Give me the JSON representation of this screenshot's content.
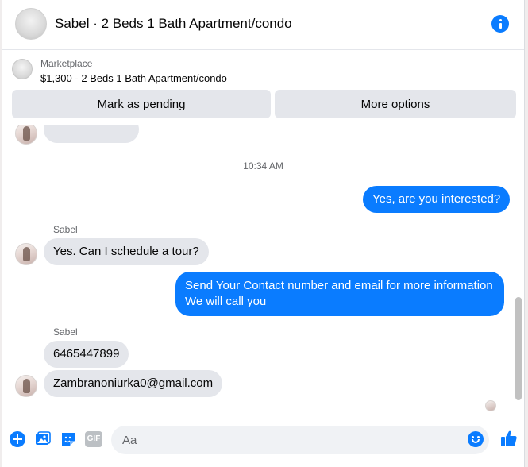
{
  "header": {
    "title": "Sabel · 2 Beds 1 Bath Apartment/condo"
  },
  "marketplace": {
    "label": "Marketplace",
    "listing": "$1,300 - 2 Beds 1 Bath Apartment/condo",
    "pending_button": "Mark as pending",
    "more_button": "More options"
  },
  "thread": {
    "timestamp": "10:34 AM",
    "messages": [
      {
        "from": "me",
        "text": "Yes, are you interested?"
      },
      {
        "from": "Sabel",
        "sender": "Sabel",
        "text": "Yes. Can I schedule a tour?"
      },
      {
        "from": "me",
        "lines": [
          "Send Your Contact number and email for more information",
          "We will call you"
        ]
      },
      {
        "from": "Sabel",
        "sender": "Sabel",
        "text": "6465447899"
      },
      {
        "from": "Sabel",
        "text": "Zambranoniurka0@gmail.com"
      }
    ]
  },
  "composer": {
    "placeholder": "Aa",
    "gif_label": "GIF"
  },
  "colors": {
    "accent": "#0a7cff",
    "bubble_in": "#e4e6eb",
    "button_bg": "#e4e6eb"
  },
  "icons": {
    "info": "info-icon",
    "add": "plus-circle-icon",
    "photo": "photo-icon",
    "sticker": "sticker-icon",
    "gif": "gif-icon",
    "emoji": "emoji-icon",
    "like": "thumbs-up-icon"
  }
}
